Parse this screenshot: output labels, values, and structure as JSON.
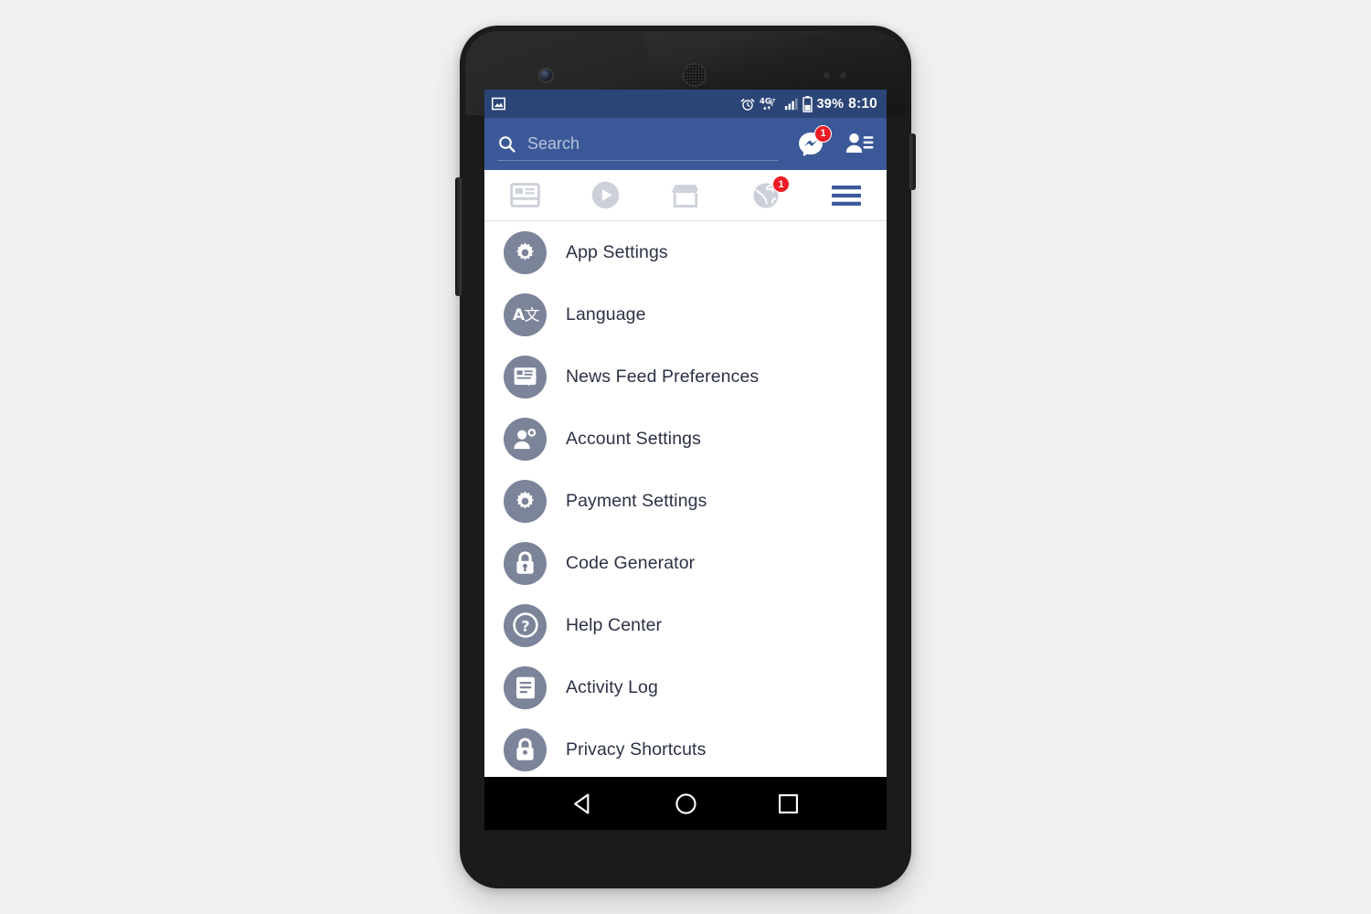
{
  "device": {
    "name": "android-phone",
    "hardware": {
      "front_camera": "front-camera",
      "earpiece": "earpiece-speaker",
      "sensors": [
        "proximity-sensor",
        "light-sensor"
      ],
      "power_button": "power-button",
      "volume_rocker": "volume-rocker"
    }
  },
  "status_bar": {
    "left_icons": [
      {
        "name": "screenshot-notification-icon",
        "glyph": "image"
      }
    ],
    "right_icons": [
      {
        "name": "alarm-clock-icon",
        "glyph": "alarm"
      },
      {
        "name": "network-4glte-icon",
        "label": "4G LTE"
      },
      {
        "name": "signal-strength-icon",
        "bars": 3
      },
      {
        "name": "battery-icon",
        "level": 39
      }
    ],
    "battery_percent": "39%",
    "clock": "8:10"
  },
  "action_bar": {
    "search": {
      "placeholder": "Search",
      "value": "",
      "icon": "search-icon"
    },
    "messenger": {
      "icon": "messenger-icon",
      "badge": "1"
    },
    "friend_requests": {
      "icon": "friend-requests-icon"
    }
  },
  "tab_bar": {
    "tabs": [
      {
        "name": "tab-news-feed",
        "icon": "news-feed-icon",
        "active": false,
        "badge": ""
      },
      {
        "name": "tab-watch",
        "icon": "video-play-icon",
        "active": false,
        "badge": ""
      },
      {
        "name": "tab-marketplace",
        "icon": "marketplace-icon",
        "active": false,
        "badge": ""
      },
      {
        "name": "tab-notifications",
        "icon": "globe-icon",
        "active": false,
        "badge": "1"
      },
      {
        "name": "tab-menu",
        "icon": "hamburger-menu-icon",
        "active": true,
        "badge": ""
      }
    ]
  },
  "menu": {
    "items": [
      {
        "label": "App Settings",
        "icon": "gear-icon"
      },
      {
        "label": "Language",
        "icon": "language-icon"
      },
      {
        "label": "News Feed Preferences",
        "icon": "news-feed-preferences-icon"
      },
      {
        "label": "Account Settings",
        "icon": "account-settings-icon"
      },
      {
        "label": "Payment Settings",
        "icon": "gear-icon"
      },
      {
        "label": "Code Generator",
        "icon": "lock-icon"
      },
      {
        "label": "Help Center",
        "icon": "question-mark-icon"
      },
      {
        "label": "Activity Log",
        "icon": "activity-log-icon"
      },
      {
        "label": "Privacy Shortcuts",
        "icon": "privacy-lock-icon"
      }
    ]
  },
  "nav_bar": {
    "buttons": [
      {
        "name": "back-button",
        "icon": "back-triangle-icon"
      },
      {
        "name": "home-button",
        "icon": "home-circle-icon"
      },
      {
        "name": "recents-button",
        "icon": "recents-square-icon"
      }
    ]
  },
  "colors": {
    "facebook_blue": "#3b5998",
    "status_bar_blue": "#2c4577",
    "badge_red": "#ed1c24",
    "icon_grey": "#7c8499",
    "text_dark": "#2c3145",
    "tab_inactive": "#ccd0d9",
    "tab_active": "#3b5998",
    "page_bg": "#f1f1f1"
  }
}
